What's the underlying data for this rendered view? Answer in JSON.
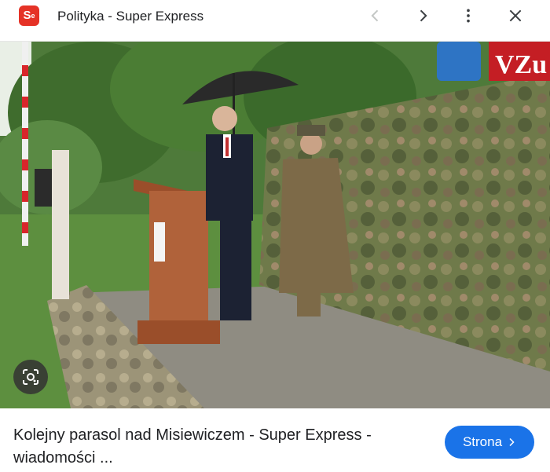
{
  "header": {
    "favicon_text": "S",
    "favicon_superscript": "e",
    "title": "Polityka - Super Express"
  },
  "icons": {
    "back": "chevron-left-icon",
    "forward": "chevron-right-icon",
    "menu": "more-vert-icon",
    "close": "close-icon",
    "lens": "google-lens-icon"
  },
  "image": {
    "banner_text": "VZu"
  },
  "result": {
    "caption": "Kolejny parasol nad Misiewiczem - Super Express - wiadomości ...",
    "visit_button": "Strona"
  },
  "colors": {
    "brand_red": "#e53226",
    "accent_blue": "#1a73e8"
  }
}
